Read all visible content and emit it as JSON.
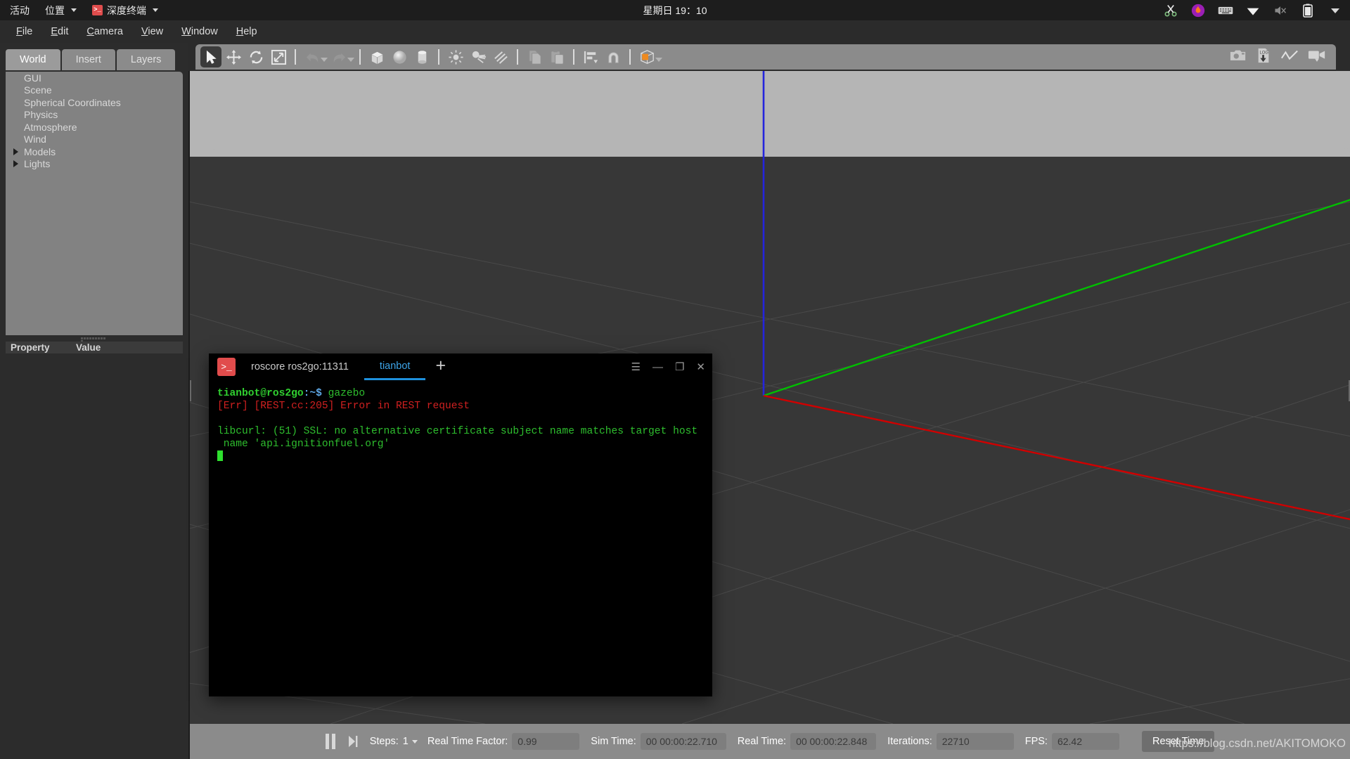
{
  "desktop": {
    "activities": "活动",
    "places": "位置",
    "app_name": "深度终端",
    "clock": "星期日 19：10",
    "tray": [
      {
        "name": "scissors-icon",
        "glyph": "✂"
      },
      {
        "name": "flame-icon",
        "glyph": "🔥"
      },
      {
        "name": "keyboard-icon",
        "glyph": "⌨"
      },
      {
        "name": "wifi-icon",
        "glyph": "▼"
      },
      {
        "name": "volume-muted-icon",
        "glyph": "🔇"
      },
      {
        "name": "battery-icon",
        "glyph": "▮"
      },
      {
        "name": "chevron-down-icon",
        "glyph": "▾"
      }
    ]
  },
  "menubar": {
    "items": [
      {
        "mnemonic": "F",
        "rest": "ile"
      },
      {
        "mnemonic": "E",
        "rest": "dit"
      },
      {
        "mnemonic": "C",
        "rest": "amera"
      },
      {
        "mnemonic": "V",
        "rest": "iew"
      },
      {
        "mnemonic": "W",
        "rest": "indow"
      },
      {
        "mnemonic": "H",
        "rest": "elp"
      }
    ]
  },
  "left_panel": {
    "tabs": [
      {
        "label": "World",
        "active": true
      },
      {
        "label": "Insert",
        "active": false
      },
      {
        "label": "Layers",
        "active": false
      }
    ],
    "tree": [
      {
        "label": "GUI",
        "expandable": false
      },
      {
        "label": "Scene",
        "expandable": false
      },
      {
        "label": "Spherical Coordinates",
        "expandable": false
      },
      {
        "label": "Physics",
        "expandable": false
      },
      {
        "label": "Atmosphere",
        "expandable": false
      },
      {
        "label": "Wind",
        "expandable": false
      },
      {
        "label": "Models",
        "expandable": true
      },
      {
        "label": "Lights",
        "expandable": true
      }
    ],
    "property_header": {
      "property": "Property",
      "value": "Value"
    }
  },
  "toolbar": {
    "left_tools": [
      {
        "name": "select-tool",
        "glyph": "arrow",
        "active": true
      },
      {
        "name": "translate-tool",
        "glyph": "move",
        "active": false
      },
      {
        "name": "rotate-tool",
        "glyph": "rotate",
        "active": false
      },
      {
        "name": "scale-tool",
        "glyph": "scale",
        "active": false
      }
    ],
    "history_tools": [
      {
        "name": "undo-button",
        "glyph": "undo"
      },
      {
        "name": "undo-dropdown",
        "glyph": "caret"
      },
      {
        "name": "redo-button",
        "glyph": "redo"
      },
      {
        "name": "redo-dropdown",
        "glyph": "caret"
      }
    ],
    "shape_tools": [
      {
        "name": "insert-box-button",
        "glyph": "box"
      },
      {
        "name": "insert-sphere-button",
        "glyph": "sphere"
      },
      {
        "name": "insert-cylinder-button",
        "glyph": "cylinder"
      }
    ],
    "light_tools": [
      {
        "name": "insert-point-light-button",
        "glyph": "point-light"
      },
      {
        "name": "insert-spot-light-button",
        "glyph": "spot-light"
      },
      {
        "name": "insert-directional-light-button",
        "glyph": "directional-light"
      }
    ],
    "clipboard_tools": [
      {
        "name": "copy-button",
        "glyph": "copy"
      },
      {
        "name": "paste-button",
        "glyph": "paste"
      }
    ],
    "align_tools": [
      {
        "name": "align-button",
        "glyph": "align"
      },
      {
        "name": "snap-button",
        "glyph": "magnet"
      }
    ],
    "view_tools": [
      {
        "name": "view-appearance-button",
        "glyph": "orange-cube"
      },
      {
        "name": "view-appearance-dropdown",
        "glyph": "caret"
      }
    ],
    "right_tools": [
      {
        "name": "screenshot-button",
        "glyph": "camera"
      },
      {
        "name": "save-log-button",
        "glyph": "log"
      },
      {
        "name": "plot-button",
        "glyph": "plot"
      },
      {
        "name": "record-video-button",
        "glyph": "video"
      }
    ]
  },
  "terminal": {
    "window_title": "深度终端",
    "tabs": [
      {
        "label": "roscore ros2go:11311",
        "active": false
      },
      {
        "label": "tianbot",
        "active": true
      }
    ],
    "new_tab_label": "+",
    "controls": [
      {
        "name": "terminal-menu-button",
        "glyph": "☰"
      },
      {
        "name": "terminal-minimize-button",
        "glyph": "—"
      },
      {
        "name": "terminal-maximize-button",
        "glyph": "❐"
      },
      {
        "name": "terminal-close-button",
        "glyph": "✕"
      }
    ],
    "prompt_user": "tianbot@ros2go",
    "prompt_path": ":~$",
    "command": " gazebo",
    "lines": [
      {
        "text": "[Err] [REST.cc:205] Error in REST request",
        "color": "red"
      },
      {
        "text": "",
        "color": "green"
      },
      {
        "text": "libcurl: (51) SSL: no alternative certificate subject name matches target host",
        "color": "green"
      },
      {
        "text": " name 'api.ignitionfuel.org'",
        "color": "green"
      }
    ]
  },
  "statusbar": {
    "pause_button": "pause",
    "step_button": "step",
    "steps_label": "Steps:",
    "steps_value": "1",
    "rtf_label": "Real Time Factor:",
    "rtf_value": "0.99",
    "sim_time_label": "Sim Time:",
    "sim_time_value": "00 00:00:22.710",
    "real_time_label": "Real Time:",
    "real_time_value": "00 00:00:22.848",
    "iterations_label": "Iterations:",
    "iterations_value": "22710",
    "fps_label": "FPS:",
    "fps_value": "62.42",
    "reset_label": "Reset Time"
  },
  "watermark": "https://blog.csdn.net/AKITOMOKO",
  "colors": {
    "x_axis": "#cc0000",
    "y_axis": "#00bb00",
    "z_axis": "#2222dd",
    "accent": "#1e90dc",
    "panel": "#828282",
    "chrome": "#2b2b2b"
  }
}
